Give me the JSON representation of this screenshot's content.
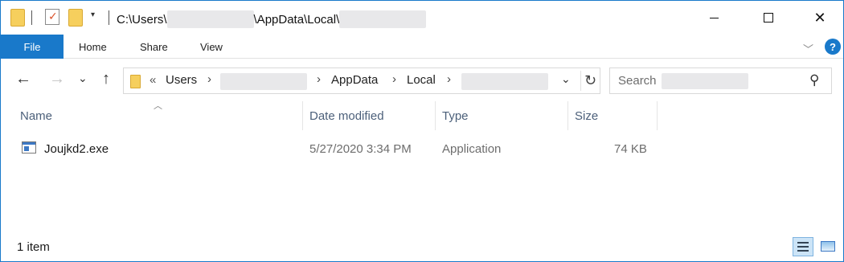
{
  "titlebar": {
    "path_prefix": "C:\\Users\\",
    "path_middle": "\\AppData\\Local\\",
    "minimize_label": "",
    "maximize_label": "",
    "close_label": "✕"
  },
  "ribbon": {
    "tabs": [
      "File",
      "Home",
      "Share",
      "View"
    ],
    "help_label": "?"
  },
  "nav": {
    "back": "←",
    "forward": "→",
    "recent": "⌄",
    "up": "↑"
  },
  "address": {
    "overflow": "«",
    "crumbs": [
      "Users",
      "AppData",
      "Local"
    ],
    "separator": "›"
  },
  "search": {
    "placeholder": "Search"
  },
  "columns": [
    "Name",
    "Date modified",
    "Type",
    "Size"
  ],
  "files": [
    {
      "name": "Joujkd2.exe",
      "date_modified": "5/27/2020 3:34 PM",
      "type": "Application",
      "size": "74 KB",
      "icon": "application-exe-icon"
    }
  ],
  "status": {
    "item_count": "1 item"
  },
  "colors": {
    "accent": "#1979ca",
    "header_text": "#4c607a"
  }
}
